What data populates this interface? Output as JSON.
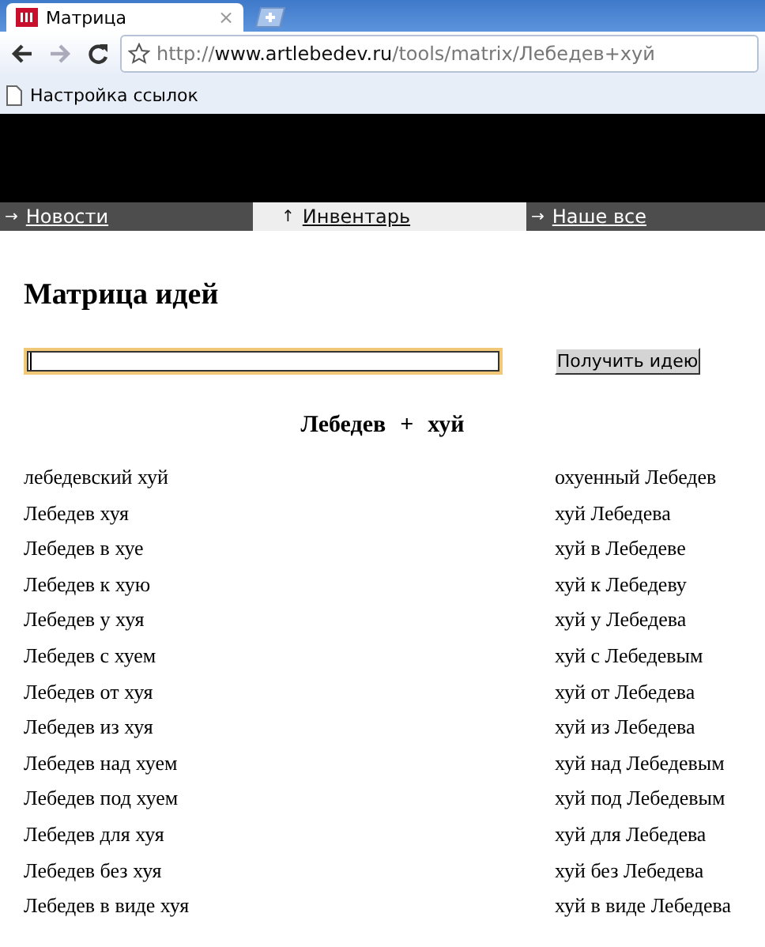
{
  "browser": {
    "tab": {
      "title": "Матрица",
      "close": "×",
      "selected": true
    },
    "url": [
      {
        "text": "http://",
        "kind": "scheme"
      },
      {
        "text": "www.artlebedev.ru",
        "kind": "host"
      },
      {
        "text": "/tools/matrix/Лебедев+хуй",
        "kind": "path"
      }
    ],
    "bookmarks": [
      "Настройка ссылок"
    ]
  },
  "nav": [
    {
      "arrow": "→",
      "label": "Новости",
      "selected": false
    },
    {
      "arrow": "↑",
      "label": "Инвентарь",
      "selected": true
    },
    {
      "arrow": "→",
      "label": "Наше все",
      "selected": false
    }
  ],
  "page": {
    "title": "Матрица идей",
    "input": {
      "focused": true
    },
    "button": "Получить идею",
    "pair": [
      "Лебедев",
      "+",
      "хуй"
    ],
    "rows": [
      [
        "лебедевский хуй",
        "охуенный Лебедев"
      ],
      [
        "Лебедев хуя",
        "хуй Лебедева"
      ],
      [
        "Лебедев в хуе",
        "хуй в Лебедеве"
      ],
      [
        "Лебедев к хую",
        "хуй к Лебедеву"
      ],
      [
        "Лебедев у хуя",
        "хуй у Лебедева"
      ],
      [
        "Лебедев с хуем",
        "хуй с Лебедевым"
      ],
      [
        "Лебедев от хуя",
        "хуй от Лебедева"
      ],
      [
        "Лебедев из хуя",
        "хуй из Лебедева"
      ],
      [
        "Лебедев над хуем",
        "хуй над Лебедевым"
      ],
      [
        "Лебедев под хуем",
        "хуй под Лебедевым"
      ],
      [
        "Лебедев для хуя",
        "хуй для Лебедева"
      ],
      [
        "Лебедев без хуя",
        "хуй без Лебедева"
      ],
      [
        "Лебедев в виде хуя",
        "хуй в виде Лебедева"
      ]
    ]
  }
}
